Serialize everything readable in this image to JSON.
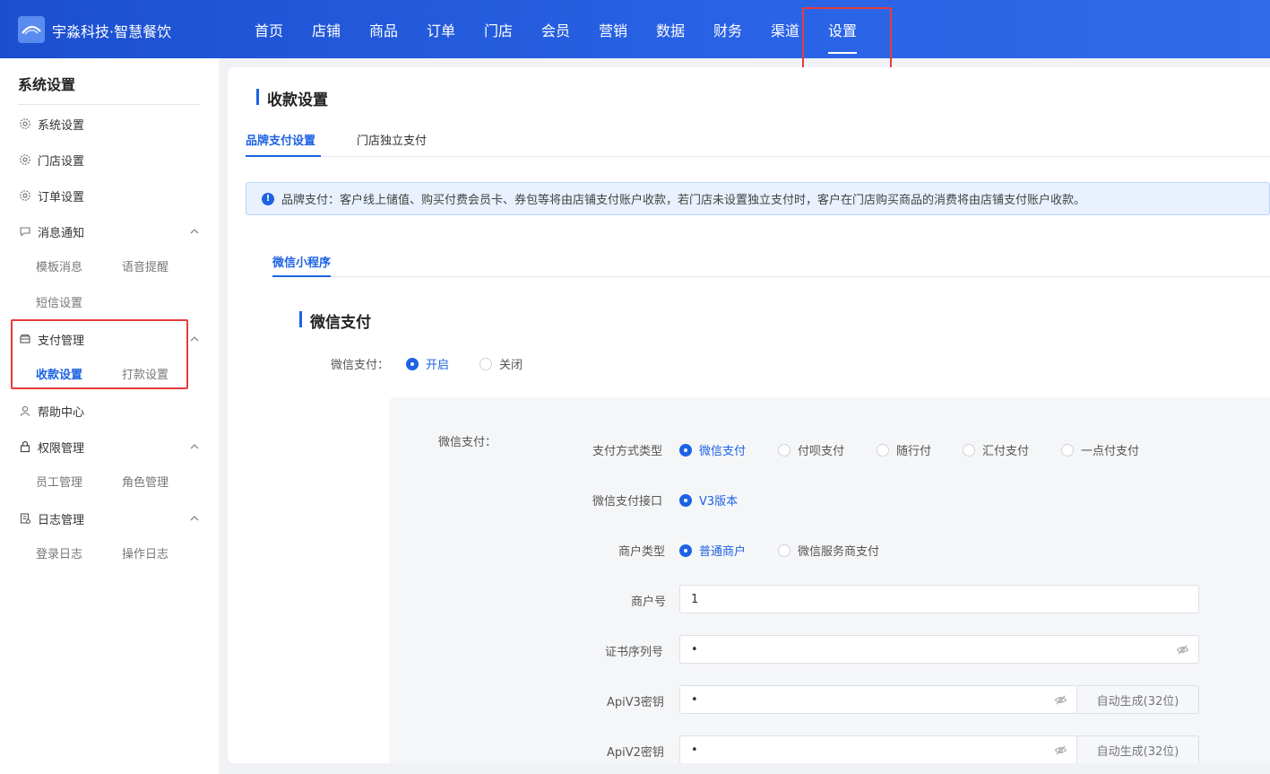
{
  "header": {
    "brand": "宇淼科技·智慧餐饮",
    "nav": [
      "首页",
      "店铺",
      "商品",
      "订单",
      "门店",
      "会员",
      "营销",
      "数据",
      "财务",
      "渠道",
      "设置"
    ],
    "active_nav": "设置"
  },
  "sidebar": {
    "title": "系统设置",
    "items": {
      "system": "系统设置",
      "store": "门店设置",
      "order": "订单设置",
      "message": "消息通知",
      "payment": "支付管理",
      "help": "帮助中心",
      "permission": "权限管理",
      "log": "日志管理"
    },
    "subs": {
      "template_msg": "模板消息",
      "voice_alert": "语音提醒",
      "sms": "短信设置",
      "receive": "收款设置",
      "transfer": "打款设置",
      "staff": "员工管理",
      "role": "角色管理",
      "login_log": "登录日志",
      "op_log": "操作日志"
    }
  },
  "main": {
    "title": "收款设置",
    "tabs": [
      "品牌支付设置",
      "门店独立支付"
    ],
    "alert": "品牌支付：客户线上储值、购买付费会员卡、券包等将由店铺支付账户收款，若门店未设置独立支付时，客户在门店购买商品的消费将由店铺支付账户收款。",
    "subtab": "微信小程序",
    "section_title": "微信支付",
    "wechat_pay": {
      "label": "微信支付：",
      "on": "开启",
      "off": "关闭"
    },
    "config": {
      "box_label": "微信支付：",
      "pay_type_label": "支付方式类型",
      "pay_types": [
        "微信支付",
        "付呗支付",
        "随行付",
        "汇付支付",
        "一点付支付"
      ],
      "api_label": "微信支付接口",
      "api_version": "V3版本",
      "merchant_type_label": "商户类型",
      "merchant_types": [
        "普通商户",
        "微信服务商支付"
      ],
      "merchant_no_label": "商户号",
      "merchant_no": "1",
      "cert_serial_label": "证书序列号",
      "cert_serial": "•",
      "apiv3_label": "ApiV3密钥",
      "apiv3": "•",
      "apiv2_label": "ApiV2密钥",
      "apiv2": "•",
      "auto_gen": "自动生成(32位)"
    }
  },
  "colors": {
    "primary": "#1d63e3",
    "header": "#2a63e6",
    "highlight": "#e83b3b"
  }
}
